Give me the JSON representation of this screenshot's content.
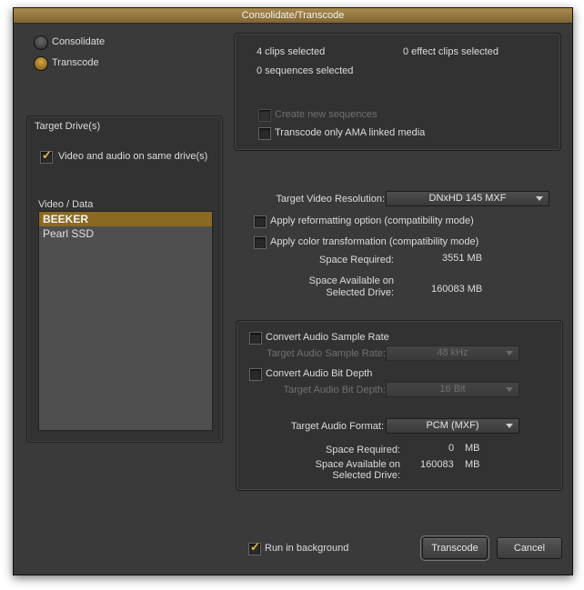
{
  "window": {
    "title": "Consolidate/Transcode"
  },
  "mode": {
    "options": [
      {
        "label": "Consolidate",
        "selected": false
      },
      {
        "label": "Transcode",
        "selected": true
      }
    ]
  },
  "target_drives": {
    "header": "Target Drive(s)",
    "same_drive_label": "Video and audio on same drive(s)",
    "same_drive_checked": true,
    "list_label": "Video / Data",
    "drives": [
      "BEEKER",
      "Pearl SSD"
    ],
    "selected_drive": "BEEKER"
  },
  "selection_info": {
    "clips": "4 clips selected",
    "effect_clips": "0 effect clips selected",
    "sequences": "0 sequences selected",
    "create_sequences_label": "Create new sequences",
    "create_sequences_enabled": false,
    "ama_only_label": "Transcode only AMA linked media",
    "ama_only_checked": false
  },
  "video": {
    "resolution_label": "Target Video Resolution:",
    "resolution_value": "DNxHD 145  MXF",
    "reformat_label": "Apply reformatting option (compatibility mode)",
    "color_label": "Apply color transformation (compatibility mode)",
    "space_required_label": "Space Required:",
    "space_required_value": "3551 MB",
    "space_available_label_1": "Space Available on",
    "space_available_label_2": "Selected Drive:",
    "space_available_value": "160083 MB"
  },
  "audio": {
    "sample_rate_label": "Convert Audio Sample Rate",
    "target_sample_rate_label": "Target Audio Sample Rate:",
    "target_sample_rate_value": "48 kHz",
    "bit_depth_label": "Convert Audio Bit Depth",
    "target_bit_depth_label": "Target Audio Bit Depth:",
    "target_bit_depth_value": "16 Bit",
    "format_label": "Target Audio Format:",
    "format_value": "PCM  (MXF)",
    "space_required_label": "Space Required:",
    "space_required_value": "0",
    "space_required_unit": "MB",
    "space_available_label_1": "Space Available on",
    "space_available_label_2": "Selected Drive:",
    "space_available_value": "160083",
    "space_available_unit": "MB"
  },
  "footer": {
    "background_label": "Run in background",
    "background_checked": true,
    "transcode_button": "Transcode",
    "cancel_button": "Cancel"
  },
  "colors": {
    "accent": "#d5a640",
    "titlebar": "#8f7340",
    "panel": "#3a3a3a"
  }
}
